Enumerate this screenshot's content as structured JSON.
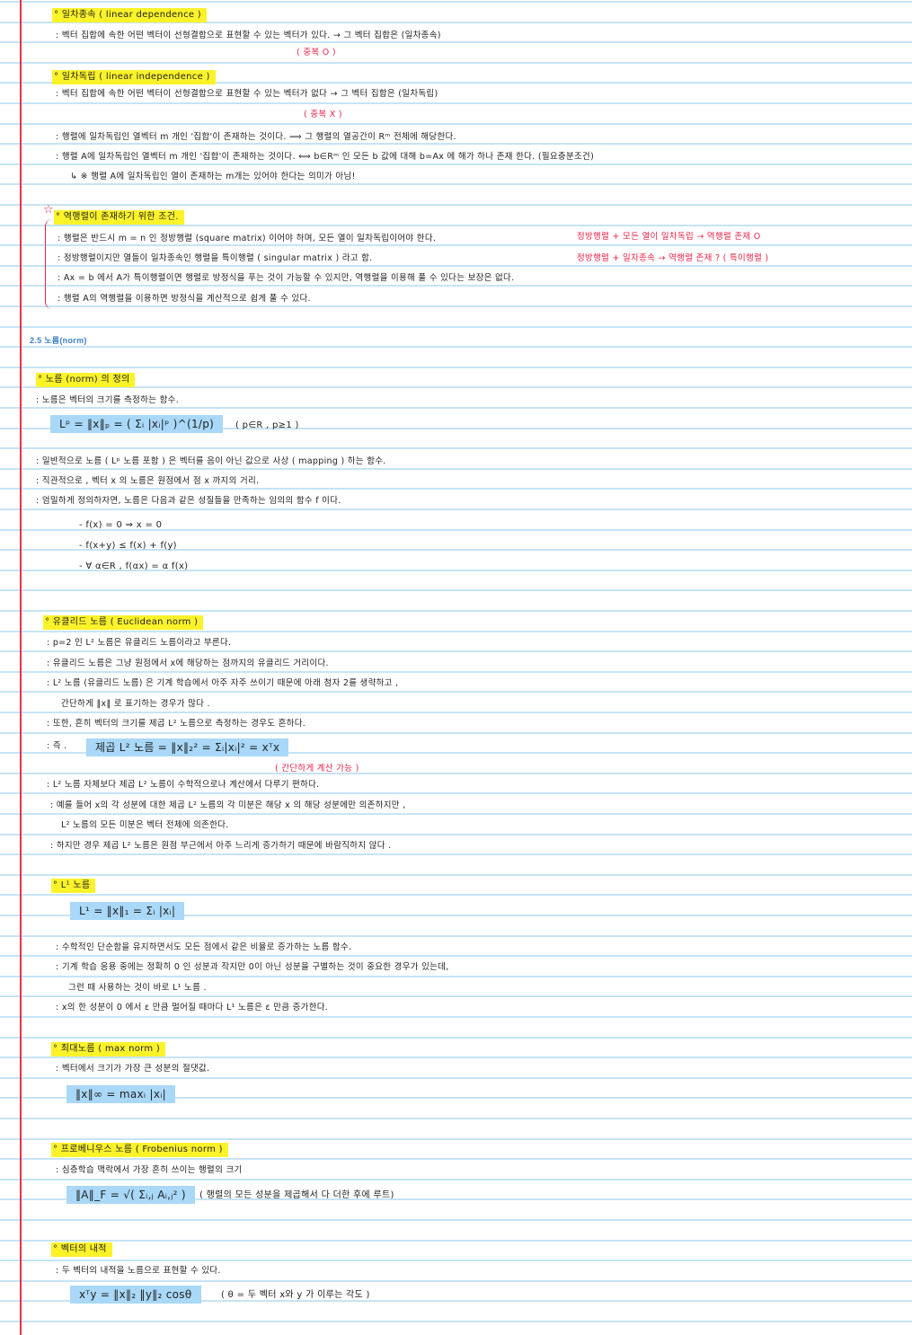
{
  "colors": {
    "highlight_yellow": "#fbf32a",
    "highlight_blue": "#a9d8f8",
    "red_ink": "#e8254a",
    "rule_line": "#c6e4f5",
    "margin_line": "#e8334a",
    "section_blue": "#3b7fc4"
  },
  "rows": [
    {
      "kind": "heading",
      "text": "° 일차종속 ( linear dependence )"
    },
    {
      "kind": "text",
      "text": ": 벡터 집합에 속한 어떤 벡터이 선형결합으로 표현할 수 있는 벡터가 있다.  →  그 벡터 집합은 (일차종속)"
    },
    {
      "kind": "red",
      "text": "( 중복 O )"
    },
    {
      "kind": "heading",
      "text": "° 일차독립 ( linear independence )"
    },
    {
      "kind": "text",
      "text": ": 벡터 집합에 속한 어떤 벡터이 선형결합으로 표현할 수 있는 벡터가 없다  →  그 벡터 집합은 (일차독립)"
    },
    {
      "kind": "red",
      "text": "( 중복 X )"
    },
    {
      "kind": "text",
      "text": ": 행렬에 일차독립인 열벡터 m 개인 '집합'이 존재하는 것이다.  ⟹  그 행렬의 열공간이  Rᵐ 전체에 해당한다."
    },
    {
      "kind": "text",
      "text": ": 행렬 A에 일차독립인 열벡터 m 개인 '집합'이 존재하는 것이다. ⟺  b∈Rᵐ 인 모든 b 값에 대해  b=Ax 에 해가 하나 존재 한다. (필요충분조건)"
    },
    {
      "kind": "text",
      "text": "↳ ※ 행렬 A에 일차독립인 열이 존재하는 m개는 있어야 한다는 의미가 아님!"
    },
    {
      "kind": "heading",
      "text": "° 역행렬이 존재하기 위한 조건."
    },
    {
      "kind": "text",
      "text": ": 행렬은 반드시  m = n 인  정방행렬 (square matrix) 이어야 하며,  모든 열이 일차독립이어야 한다."
    },
    {
      "kind": "text",
      "text": ": 정방행렬이지만  열들이  일차종속인  행렬을  특이행렬 ( singular matrix ) 라고 함."
    },
    {
      "kind": "text",
      "text": ": Ax = b 에서   A가 특이행렬이면  행렬로 방정식을 푸는 것이 가능할 수 있지만,  역행렬을 이용해  풀 수 있다는  보장은 없다."
    },
    {
      "kind": "text",
      "text": ": 행렬 A의 역행렬을 이용하면  방정식을  계산적으로  쉽게 풀 수 있다."
    },
    {
      "kind": "red",
      "text": "정방행렬   +   모든 열이 일차독립   →   역행렬 존재 O"
    },
    {
      "kind": "red",
      "text": "정방행렬   +        일차종속        →   역행렬 존재 ?  ( 특이행렬 )"
    },
    {
      "kind": "section",
      "text": "2.5 노름(norm)"
    },
    {
      "kind": "heading",
      "text": "° 노름 (norm) 의 정의"
    },
    {
      "kind": "text",
      "text": ": 노름은 벡터의 크기를 측정하는 함수."
    },
    {
      "kind": "formula",
      "text": "Lᵖ  =  ‖x‖ₚ  =  ( Σᵢ |xᵢ|ᵖ )^(1/p)"
    },
    {
      "kind": "note",
      "text": "( p∈R ,  p≥1 )"
    },
    {
      "kind": "text",
      "text": ": 일반적으로  노름 ( Lᵖ 노름 포함 ) 은   벡터를 음이 아닌 값으로   사상 ( mapping ) 하는 함수."
    },
    {
      "kind": "text",
      "text": ": 직관적으로 ,   벡터 x 의 노름은  원점에서  점 x 까지의 거리."
    },
    {
      "kind": "text",
      "text": ": 엄밀하게 정의하자면,  노름은 다음과 같은  성질들을  만족하는   임의의 함수 f 이다."
    },
    {
      "kind": "note",
      "text": "-   f(x) = 0   ⇒   x = 0"
    },
    {
      "kind": "note",
      "text": "-   f(x+y)  ≤  f(x) + f(y)"
    },
    {
      "kind": "note",
      "text": "-   ∀ α∈R ,   f(αx) = α f(x)"
    },
    {
      "kind": "heading",
      "text": "° 유클리드 노름 ( Euclidean norm )"
    },
    {
      "kind": "text",
      "text": ": p=2 인   L² 노름은  유클리드  노름이라고 부른다."
    },
    {
      "kind": "text",
      "text": ": 유클리드 노름은   그냥 원점에서   x에  해당하는   점까지의  유클리드 거리이다."
    },
    {
      "kind": "text",
      "text": ": L² 노름 (유클리드 노름) 은   기계 학습에서  아주 자주 쓰이기 때문에   아래 첨자 2를 생략하고 ,"
    },
    {
      "kind": "text",
      "text": "간단하게    ‖x‖ 로 표기하는    경우가 많다 ."
    },
    {
      "kind": "text",
      "text": ": 또한,   흔히  벡터의  크기를   제곱 L² 노름으로   측정하는   경우도 흔하다."
    },
    {
      "kind": "text",
      "text": ": 즉 ."
    },
    {
      "kind": "formula",
      "text": "제곱 L² 노름   = ‖x‖₂²  =  Σᵢ|xᵢ|²  =  xᵀx"
    },
    {
      "kind": "red",
      "text": "( 간단하게 계산 가능 )"
    },
    {
      "kind": "text",
      "text": ": L² 노름  자체보다   제곱 L² 노름이  수학적으로나  계산에서  다루기  편하다."
    },
    {
      "kind": "text",
      "text": ": 예를 들어   x의  각 성분에  대한   제곱 L² 노름의   각 미분은   해당  x 의  해당 성분에만   의존하지만 ,"
    },
    {
      "kind": "text",
      "text": "L² 노름의   모든 미분은   벡터 전체에 의존한다."
    },
    {
      "kind": "text",
      "text": ": 하지만  경우   제곱 L² 노름은    원점  부근에서    아주 느리게  증가하기  때문에    바람직하지  않다 ."
    },
    {
      "kind": "heading",
      "text": "° L¹ 노름"
    },
    {
      "kind": "formula",
      "text": "L¹  =  ‖x‖₁  =  Σᵢ |xᵢ|"
    },
    {
      "kind": "text",
      "text": ": 수학적인  단순함을   유지하면서도   모든 점에서  같은 비율로   증가하는   노름 함수."
    },
    {
      "kind": "text",
      "text": ": 기계 학습 응용 중에는    정확히 0 인  성분과   작지만  0이  아닌   성분을  구별하는  것이   중요한   경우가   있는데,"
    },
    {
      "kind": "text",
      "text": "그런 때  사용하는  것이  바로   L¹ 노름 ."
    },
    {
      "kind": "text",
      "text": ": x의  한  성분이  0 에서  ε 만큼   멀어질 때마다   L¹ 노름은  ε 만큼   증가한다."
    },
    {
      "kind": "heading",
      "text": "° 최대노름 ( max norm )"
    },
    {
      "kind": "text",
      "text": ": 벡터에서   크기가  가장 큰  성분의  절댓값."
    },
    {
      "kind": "formula",
      "text": "‖x‖∞   =   maxᵢ |xᵢ|"
    },
    {
      "kind": "heading",
      "text": "° 프로베니우스 노름 ( Frobenius norm )"
    },
    {
      "kind": "text",
      "text": ": 심층학습  맥락에서   가장  흔히  쓰이는  행렬의 크기"
    },
    {
      "kind": "formula",
      "text": "‖A‖_F   =   √( Σᵢ,ⱼ Aᵢ,ⱼ² )"
    },
    {
      "kind": "note",
      "text": "( 행렬의 모든 성분을  제곱해서  다 더한 후에  루트)"
    },
    {
      "kind": "heading",
      "text": "° 벡터의 내적"
    },
    {
      "kind": "text",
      "text": ": 두 벡터의 내적을   노름으로  표현할 수 있다."
    },
    {
      "kind": "formula",
      "text": "xᵀy   =  ‖x‖₂ ‖y‖₂ cosθ"
    },
    {
      "kind": "note",
      "text": "( θ =  두 벡터  x와  y 가  이루는  각도 )"
    }
  ]
}
